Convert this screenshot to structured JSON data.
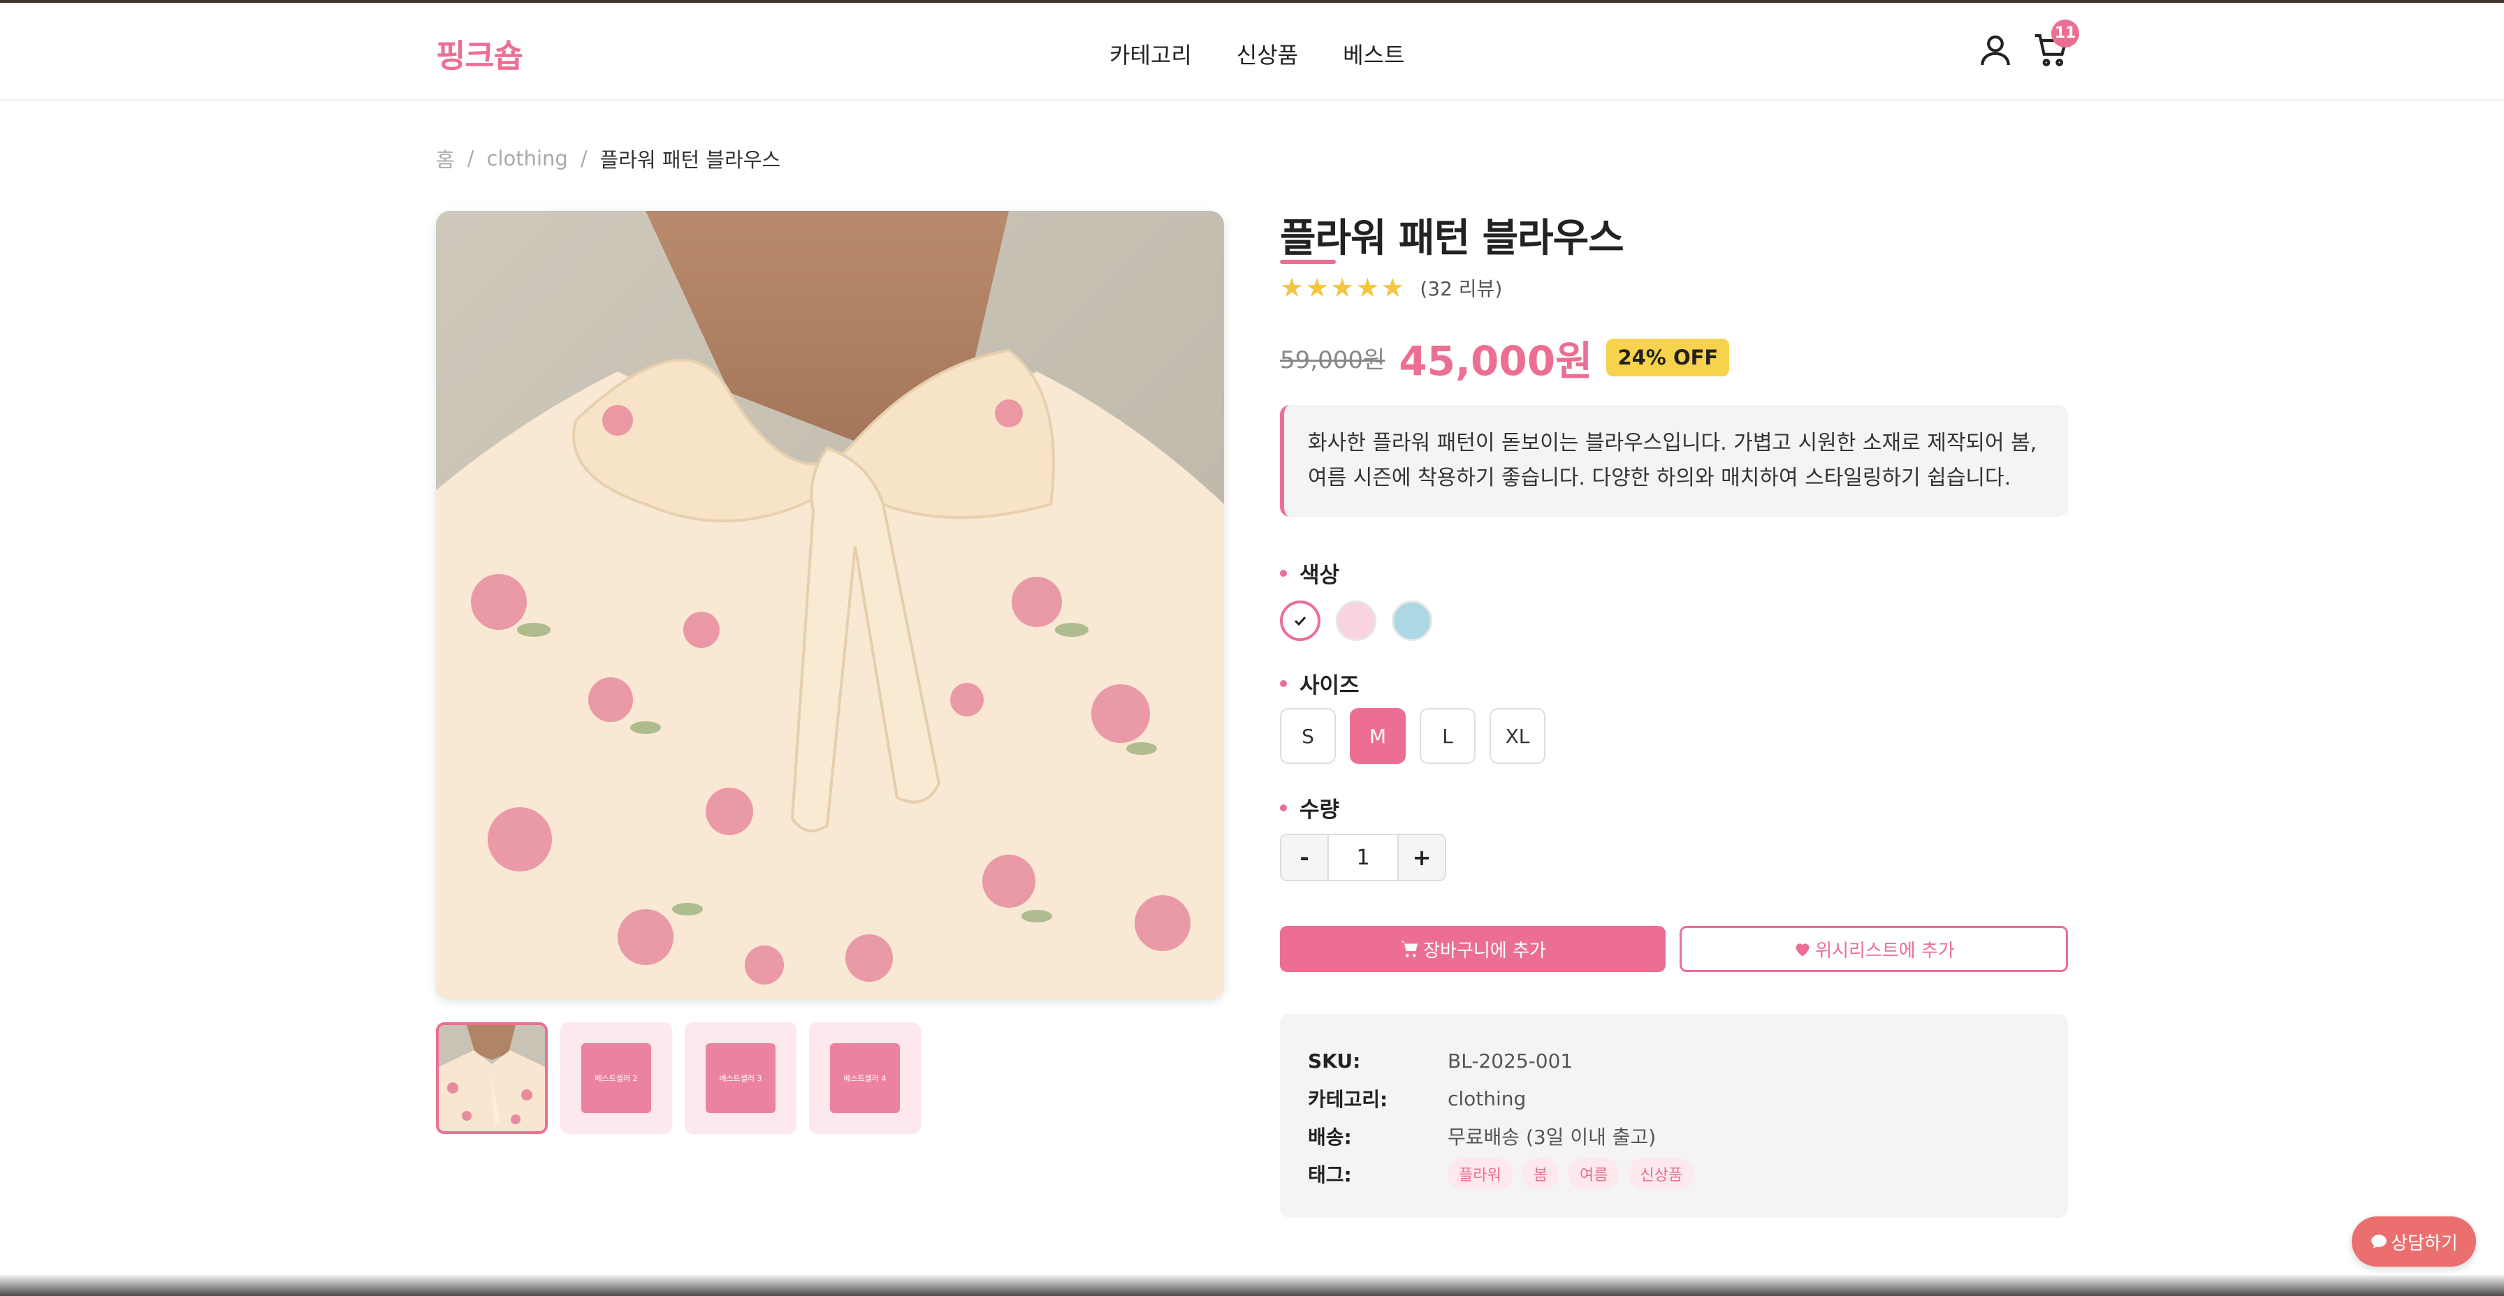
{
  "header": {
    "logo": "핑크숍",
    "nav": [
      "카테고리",
      "신상품",
      "베스트"
    ],
    "cart_count": "11"
  },
  "breadcrumb": [
    "홈",
    "clothing",
    "플라워 패턴 블라우스"
  ],
  "product": {
    "title": "플라워 패턴 블라우스",
    "stars": "★★★★★",
    "reviews": "(32 리뷰)",
    "old_price": "59,000원",
    "price": "45,000원",
    "discount": "24% OFF",
    "description": "화사한 플라워 패턴이 돋보이는 블라우스입니다. 가볍고 시원한 소재로 제작되어 봄, 여름 시즌에 착용하기 좋습니다. 다양한 하의와 매치하여 스타일링하기 쉽습니다."
  },
  "thumbnails": [
    "베스트셀러 2",
    "베스트셀러 3",
    "베스트셀러 4"
  ],
  "options": {
    "color_label": "색상",
    "colors": [
      "#ffffff",
      "#f9d3de",
      "#add8e6"
    ],
    "size_label": "사이즈",
    "sizes": [
      "S",
      "M",
      "L",
      "XL"
    ],
    "selected_size": "M",
    "qty_label": "수량",
    "qty": "1",
    "minus": "-",
    "plus": "+"
  },
  "actions": {
    "cart": "장바구니에 추가",
    "wish": "위시리스트에 추가"
  },
  "info": {
    "sku_key": "SKU:",
    "sku": "BL-2025-001",
    "cat_key": "카테고리:",
    "category": "clothing",
    "ship_key": "배송:",
    "shipping": "무료배송 (3일 이내 출고)",
    "tag_key": "태그:",
    "tags": [
      "플라워",
      "봄",
      "여름",
      "신상품"
    ]
  },
  "chat": "상담하기",
  "colors": {
    "accent": "#ec6f93",
    "star": "#f4c542",
    "badge": "#f7d24c"
  }
}
